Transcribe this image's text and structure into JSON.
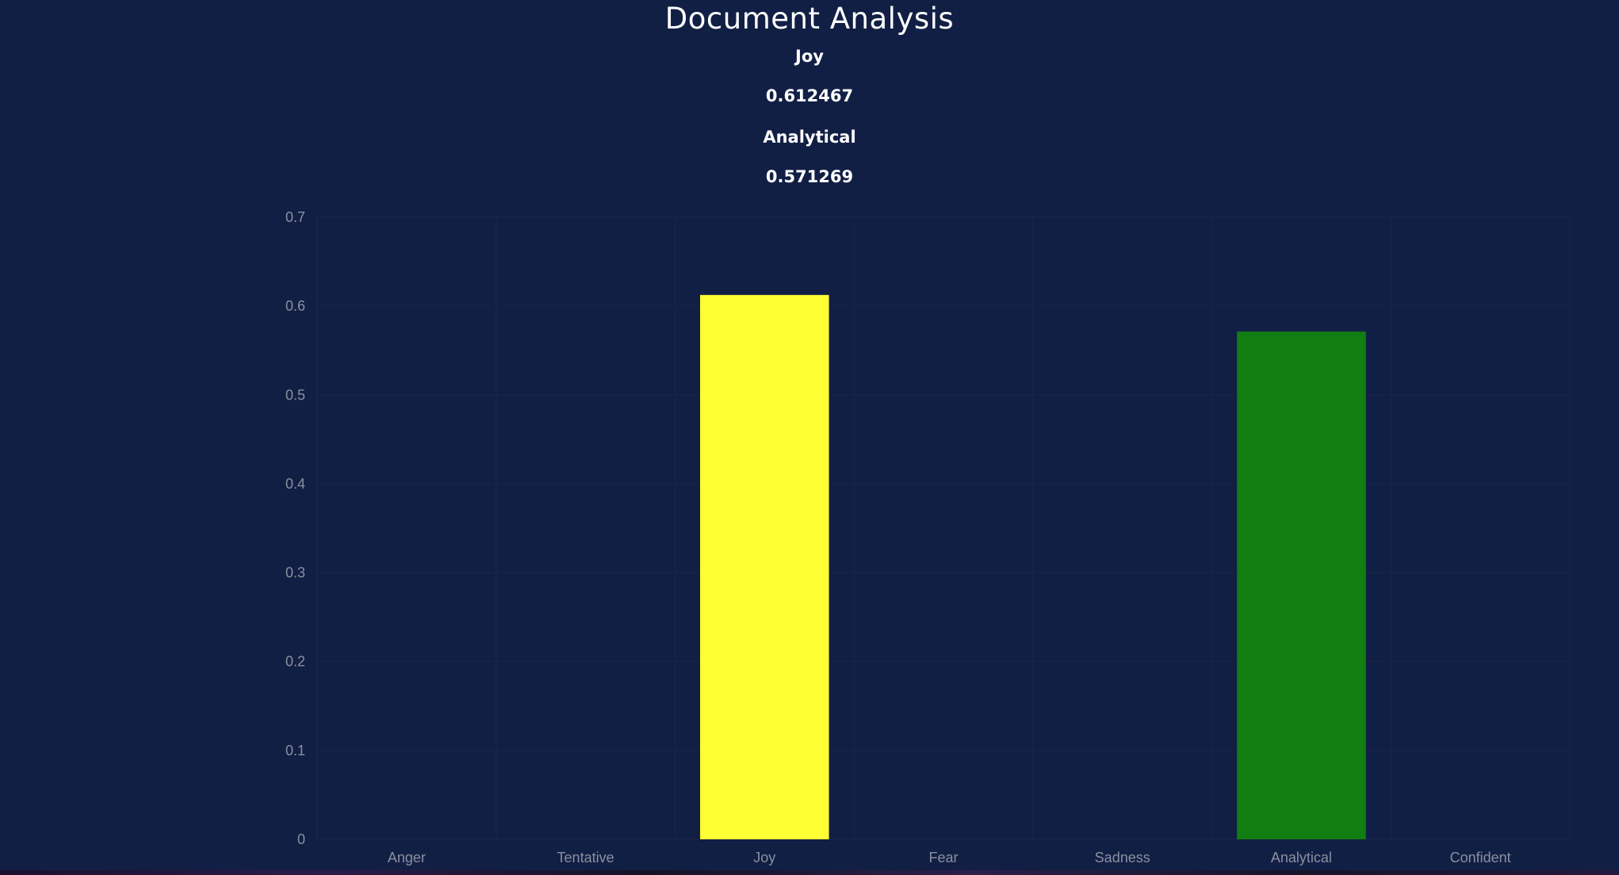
{
  "header": {
    "title": "Document Analysis",
    "tones": [
      {
        "name": "Joy",
        "score": "0.612467"
      },
      {
        "name": "Analytical",
        "score": "0.571269"
      }
    ]
  },
  "colors": {
    "background": "#121f45",
    "joy": "#ffff33",
    "analytical": "#117e11",
    "grid": "#1a2548",
    "tick_text": "#8a8f9f"
  },
  "chart_data": {
    "type": "bar",
    "categories": [
      "Anger",
      "Tentative",
      "Joy",
      "Fear",
      "Sadness",
      "Analytical",
      "Confident"
    ],
    "values": [
      0,
      0,
      0.612467,
      0,
      0,
      0.571269,
      0
    ],
    "bar_colors": [
      "#ff3333",
      "#66ccff",
      "#ffff33",
      "#9933ff",
      "#3366ff",
      "#117e11",
      "#ff9933"
    ],
    "ylim": [
      0,
      0.7
    ],
    "yticks": [
      0,
      0.1,
      0.2,
      0.3,
      0.4,
      0.5,
      0.6,
      0.7
    ],
    "ytick_labels": [
      "0",
      "0.1",
      "0.2",
      "0.3",
      "0.4",
      "0.5",
      "0.6",
      "0.7"
    ],
    "grid": true,
    "legend": "none"
  }
}
